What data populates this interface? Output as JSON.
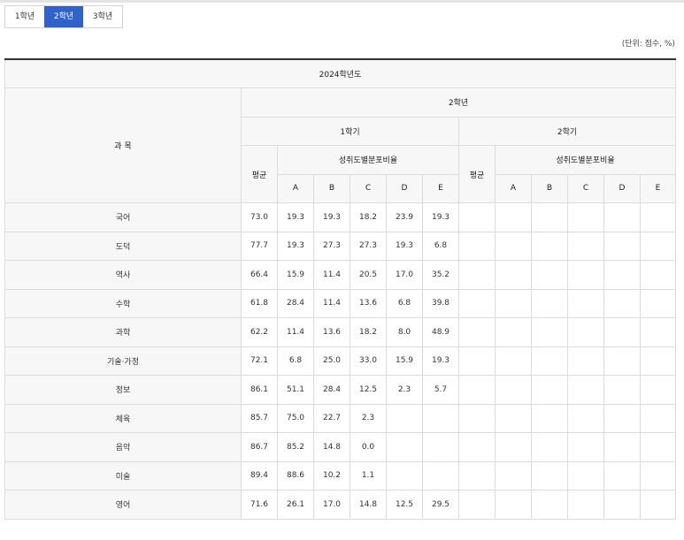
{
  "tabs": [
    {
      "label": "1학년",
      "active": false
    },
    {
      "label": "2학년",
      "active": true
    },
    {
      "label": "3학년",
      "active": false
    }
  ],
  "unit_note": "(단위: 점수, %)",
  "table": {
    "year_header": "2024학년도",
    "grade_header": "2학년",
    "subject_header": "과 목",
    "semester1": "1학기",
    "semester2": "2학기",
    "avg_header": "평균",
    "dist_header": "성취도별분포비율",
    "grade_letters": [
      "A",
      "B",
      "C",
      "D",
      "E"
    ],
    "rows": [
      {
        "subject": "국어",
        "s1": [
          "73.0",
          "19.3",
          "19.3",
          "18.2",
          "23.9",
          "19.3"
        ],
        "s2": [
          "",
          "",
          "",
          "",
          "",
          ""
        ]
      },
      {
        "subject": "도덕",
        "s1": [
          "77.7",
          "19.3",
          "27.3",
          "27.3",
          "19.3",
          "6.8"
        ],
        "s2": [
          "",
          "",
          "",
          "",
          "",
          ""
        ]
      },
      {
        "subject": "역사",
        "s1": [
          "66.4",
          "15.9",
          "11.4",
          "20.5",
          "17.0",
          "35.2"
        ],
        "s2": [
          "",
          "",
          "",
          "",
          "",
          ""
        ]
      },
      {
        "subject": "수학",
        "s1": [
          "61.8",
          "28.4",
          "11.4",
          "13.6",
          "6.8",
          "39.8"
        ],
        "s2": [
          "",
          "",
          "",
          "",
          "",
          ""
        ]
      },
      {
        "subject": "과학",
        "s1": [
          "62.2",
          "11.4",
          "13.6",
          "18.2",
          "8.0",
          "48.9"
        ],
        "s2": [
          "",
          "",
          "",
          "",
          "",
          ""
        ]
      },
      {
        "subject": "기술·가정",
        "s1": [
          "72.1",
          "6.8",
          "25.0",
          "33.0",
          "15.9",
          "19.3"
        ],
        "s2": [
          "",
          "",
          "",
          "",
          "",
          ""
        ]
      },
      {
        "subject": "정보",
        "s1": [
          "86.1",
          "51.1",
          "28.4",
          "12.5",
          "2.3",
          "5.7"
        ],
        "s2": [
          "",
          "",
          "",
          "",
          "",
          ""
        ]
      },
      {
        "subject": "체육",
        "s1": [
          "85.7",
          "75.0",
          "22.7",
          "2.3",
          "",
          ""
        ],
        "s2": [
          "",
          "",
          "",
          "",
          "",
          ""
        ]
      },
      {
        "subject": "음악",
        "s1": [
          "86.7",
          "85.2",
          "14.8",
          "0.0",
          "",
          ""
        ],
        "s2": [
          "",
          "",
          "",
          "",
          "",
          ""
        ]
      },
      {
        "subject": "미술",
        "s1": [
          "89.4",
          "88.6",
          "10.2",
          "1.1",
          "",
          ""
        ],
        "s2": [
          "",
          "",
          "",
          "",
          "",
          ""
        ]
      },
      {
        "subject": "영어",
        "s1": [
          "71.6",
          "26.1",
          "17.0",
          "14.8",
          "12.5",
          "29.5"
        ],
        "s2": [
          "",
          "",
          "",
          "",
          "",
          ""
        ]
      }
    ]
  }
}
